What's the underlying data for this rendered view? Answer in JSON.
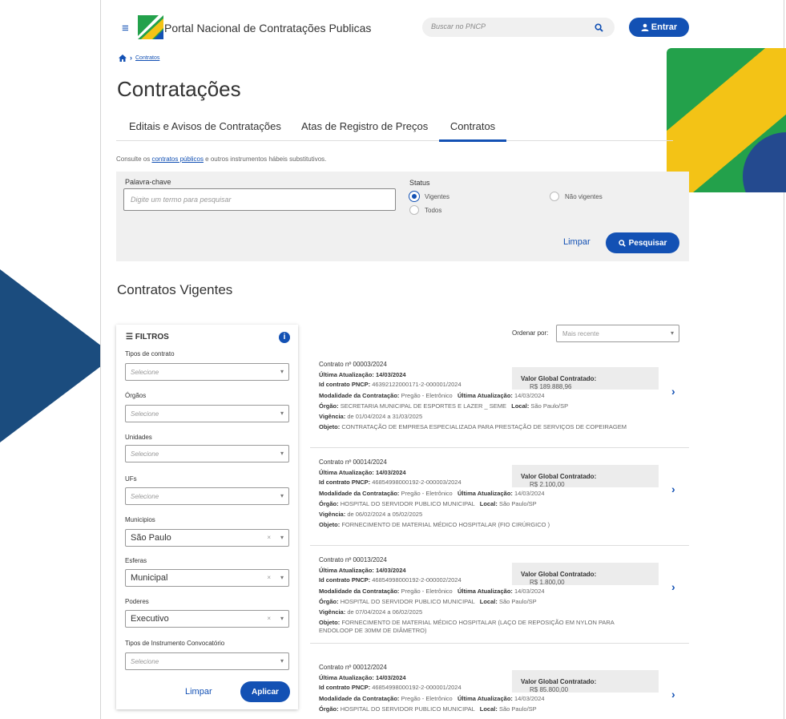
{
  "header": {
    "menu_icon": "≡",
    "site_title": "Portal Nacional de Contratações Publicas",
    "search_placeholder": "Buscar no PNCP",
    "login_label": "Entrar",
    "colors": {
      "primary": "#1351b4",
      "flag_green": "#23a14b",
      "flag_yellow": "#f3c316",
      "flag_blue": "#244a8f",
      "triangle": "#1b4c7e"
    }
  },
  "breadcrumb": {
    "current": "Contratos"
  },
  "page_title": "Contratações",
  "tabs": [
    "Editais e Avisos de Contratações",
    "Atas de Registro de Preços",
    "Contratos"
  ],
  "active_tab": "Contratos",
  "subtitle": {
    "before": "Consulte os ",
    "link": "contratos públicos",
    "after": " e outros instrumentos hábeis substitutivos."
  },
  "search_panel": {
    "keyword_label": "Palavra-chave",
    "keyword_placeholder": "Digite um termo para pesquisar",
    "status_label": "Status",
    "status_options": [
      "Vigentes",
      "Não vigentes",
      "Todos"
    ],
    "status_selected": "Vigentes",
    "clear_label": "Limpar",
    "search_label": "Pesquisar"
  },
  "section_title": "Contratos Vigentes",
  "filters": {
    "title": "FILTROS",
    "fields": [
      {
        "label": "Tipos de contrato",
        "value": "Selecione"
      },
      {
        "label": "Órgãos",
        "value": "Selecione"
      },
      {
        "label": "Unidades",
        "value": "Selecione"
      },
      {
        "label": "UFs",
        "value": "Selecione"
      },
      {
        "label": "Municipios",
        "value": "São Paulo"
      },
      {
        "label": "Esferas",
        "value": "Municipal"
      },
      {
        "label": "Poderes",
        "value": "Executivo"
      },
      {
        "label": "Tipos de Instrumento Convocatório",
        "value": "Selecione"
      }
    ],
    "clear_label": "Limpar",
    "apply_label": "Aplicar"
  },
  "order": {
    "label": "Ordenar por:",
    "value": "Mais recente"
  },
  "contracts": [
    {
      "number": "Contrato nº 00003/2024",
      "updated_label": "Última Atualização:",
      "updated": "14/03/2024",
      "id_label": "Id contrato PNCP:",
      "id": "46392122000171-2-000001/2024",
      "value_label": "Valor Global Contratado:",
      "value": "R$ 189.888,96",
      "modalidade_label": "Modalidade da Contratação:",
      "modalidade": "Pregão - Eletrônico",
      "update2_label": "Última Atualização:",
      "update2": "14/03/2024",
      "orgao_label": "Órgão:",
      "orgao": "SECRETARIA MUNICIPAL DE ESPORTES E LAZER _ SEME",
      "local_label": "Local:",
      "local": "São Paulo/SP",
      "vigencia_label": "Vigência:",
      "vigencia": "de 01/04/2024 a 31/03/2025",
      "objeto_label": "Objeto:",
      "objeto": "CONTRATAÇÃO DE EMPRESA ESPECIALIZADA PARA PRESTAÇÃO DE SERVIÇOS DE COPEIRAGEM",
      "objeto2": ""
    },
    {
      "number": "Contrato nº 00014/2024",
      "updated_label": "Última Atualização:",
      "updated": "14/03/2024",
      "id_label": "Id contrato PNCP:",
      "id": "46854998000192-2-000003/2024",
      "value_label": "Valor Global Contratado:",
      "value": "R$ 2.100,00",
      "modalidade_label": "Modalidade da Contratação:",
      "modalidade": "Pregão - Eletrônico",
      "update2_label": "Última Atualização:",
      "update2": "14/03/2024",
      "orgao_label": "Órgão:",
      "orgao": "HOSPITAL DO SERVIDOR PUBLICO MUNICIPAL",
      "local_label": "Local:",
      "local": "São Paulo/SP",
      "vigencia_label": "Vigência:",
      "vigencia": "de 06/02/2024 a 05/02/2025",
      "objeto_label": "Objeto:",
      "objeto": "FORNECIMENTO DE MATERIAL MÉDICO HOSPITALAR (FIO CIRÚRGICO )",
      "objeto2": ""
    },
    {
      "number": "Contrato nº 00013/2024",
      "updated_label": "Última Atualização:",
      "updated": "14/03/2024",
      "id_label": "Id contrato PNCP:",
      "id": "46854998000192-2-000002/2024",
      "value_label": "Valor Global Contratado:",
      "value": "R$ 1.800,00",
      "modalidade_label": "Modalidade da Contratação:",
      "modalidade": "Pregão - Eletrônico",
      "update2_label": "Última Atualização:",
      "update2": "14/03/2024",
      "orgao_label": "Órgão:",
      "orgao": "HOSPITAL DO SERVIDOR PUBLICO MUNICIPAL",
      "local_label": "Local:",
      "local": "São Paulo/SP",
      "vigencia_label": "Vigência:",
      "vigencia": "de 07/04/2024 a 06/02/2025",
      "objeto_label": "Objeto:",
      "objeto": "FORNECIMENTO DE MATERIAL MÉDICO HOSPITALAR (LAÇO DE REPOSIÇÃO EM NYLON PARA",
      "objeto2": "ENDOLOOP DE 30MM DE DIÂMETRO)"
    },
    {
      "number": "Contrato nº 00012/2024",
      "updated_label": "Última Atualização:",
      "updated": "14/03/2024",
      "id_label": "Id contrato PNCP:",
      "id": "46854998000192-2-000001/2024",
      "value_label": "Valor Global Contratado:",
      "value": "R$ 85.800,00",
      "modalidade_label": "Modalidade da Contratação:",
      "modalidade": "Pregão - Eletrônico",
      "update2_label": "Última Atualização:",
      "update2": "14/03/2024",
      "orgao_label": "Órgão:",
      "orgao": "HOSPITAL DO SERVIDOR PUBLICO MUNICIPAL",
      "local_label": "Local:",
      "local": "São Paulo/SP",
      "vigencia_label": "",
      "vigencia": "",
      "objeto_label": "",
      "objeto": "",
      "objeto2": ""
    }
  ]
}
